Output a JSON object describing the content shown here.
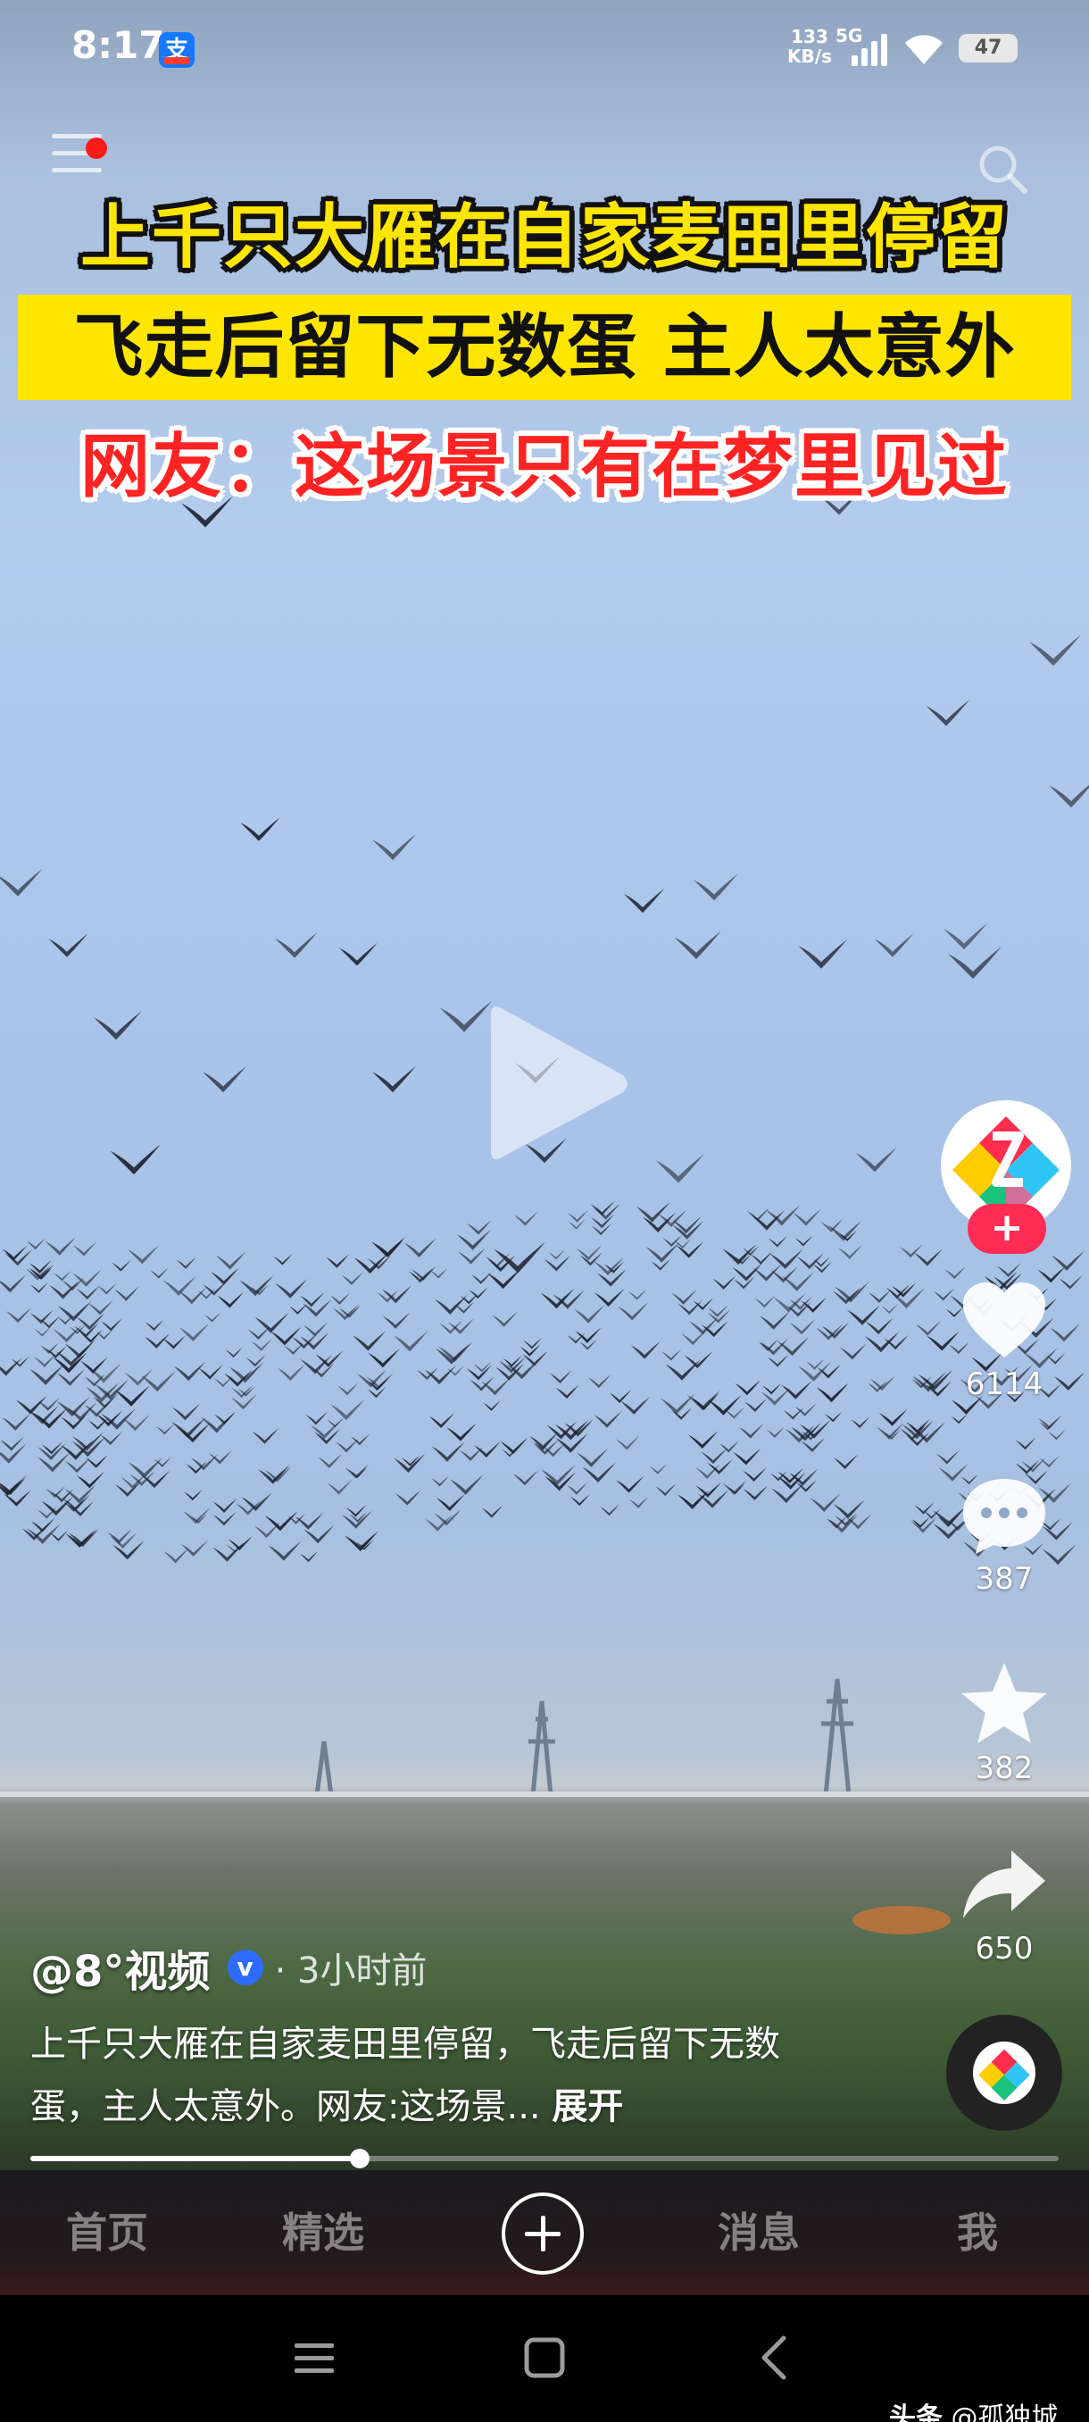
{
  "status_bar": {
    "time": "8:17",
    "app_badge": "支",
    "net_speed_value": "133",
    "net_speed_unit": "KB/s",
    "network_type": "5G",
    "battery": "47"
  },
  "video": {
    "headline_line1": "上千只大雁在自家麦田里停留",
    "headline_line2": "飞走后留下无数蛋 主人太意外",
    "headline_line3": "网友：这场景只有在梦里见过",
    "progress_fraction": 0.32
  },
  "actions": {
    "follow_label": "+",
    "likes": "6114",
    "comments": "387",
    "favorites": "382",
    "shares": "650"
  },
  "post": {
    "author": "@8°视频",
    "verified_mark": "v",
    "time": "· 3小时前",
    "caption": "上千只大雁在自家麦田里停留，飞走后留下无数蛋，主人太意外。网友:这场景... ",
    "expand_label": "展开"
  },
  "tabs": [
    {
      "label": "首页"
    },
    {
      "label": "精选"
    },
    {
      "label": "消息"
    },
    {
      "label": "我"
    }
  ],
  "watermark": {
    "brand": "头条",
    "account": "@孤独城"
  },
  "colors": {
    "headline_yellow": "#ffe600",
    "headline_red": "#ff2323",
    "follow_pink": "#fe2c55",
    "verified_blue": "#2f6bff"
  }
}
